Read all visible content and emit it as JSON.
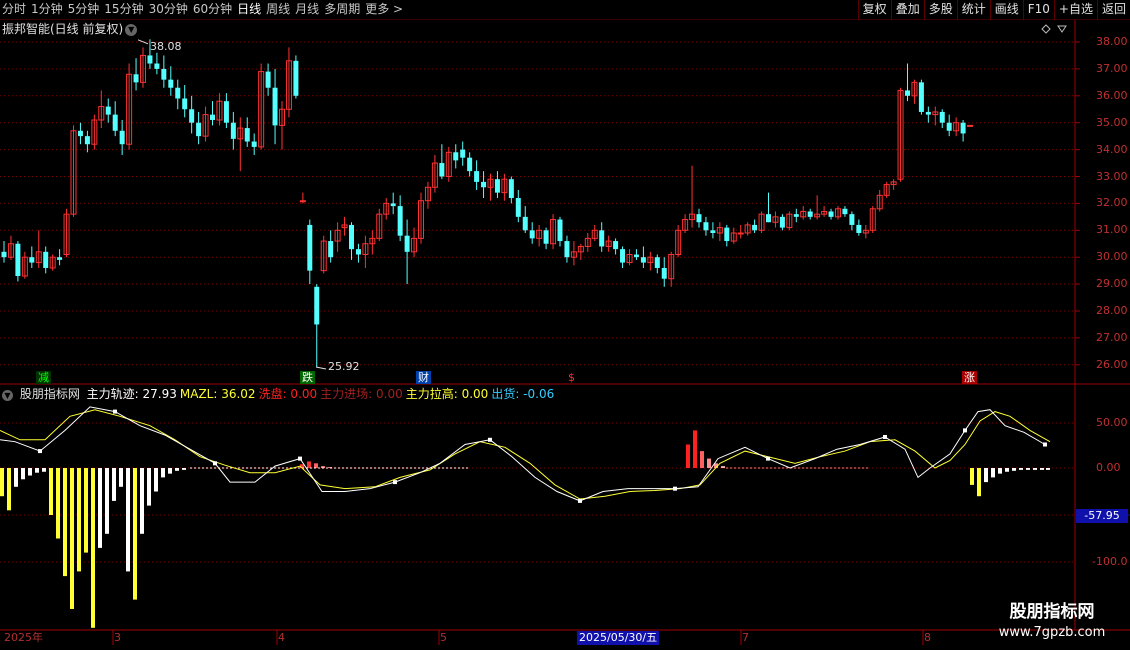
{
  "toolbar": {
    "periods": [
      "分时",
      "1分钟",
      "5分钟",
      "15分钟",
      "30分钟",
      "60分钟",
      "日线",
      "周线",
      "月线",
      "多周期",
      "更多 >"
    ],
    "active": "日线",
    "right_buttons": [
      "复权",
      "叠加",
      "多股",
      "统计",
      "画线",
      "F10",
      "+自选",
      "返回"
    ]
  },
  "stock": {
    "title": "振邦智能(日线 前复权)"
  },
  "price_axis": [
    "38.00",
    "37.00",
    "36.00",
    "35.00",
    "34.00",
    "33.00",
    "32.00",
    "31.00",
    "30.00",
    "29.00",
    "28.00",
    "27.00",
    "26.00"
  ],
  "annotations": {
    "high": "38.08",
    "low": "25.92"
  },
  "markers": [
    "减",
    "跌",
    "财",
    "$",
    "涨"
  ],
  "indicator": {
    "name": "股朋指标网",
    "fields": [
      {
        "label": "主力轨迹: 27.93",
        "color": "#ffffff"
      },
      {
        "label": "MAZL: 36.02",
        "color": "#ffff33"
      },
      {
        "label": "洗盘: 0.00",
        "color": "#ff2020"
      },
      {
        "label": "主力进场: 0.00",
        "color": "#a02020"
      },
      {
        "label": "主力拉高: 0.00",
        "color": "#ffff33"
      },
      {
        "label": "出货: -0.06",
        "color": "#33ccff"
      }
    ],
    "axis": [
      "50.00",
      "0.00",
      "-100.0"
    ],
    "cursor_value": "-57.95"
  },
  "dates": [
    "2025年",
    "3",
    "4",
    "5",
    "7",
    "8"
  ],
  "date_highlight": "2025/05/30/五",
  "watermark": {
    "title": "股朋指标网",
    "url": "www.7gpzb.com"
  },
  "colors": {
    "up": "#ff3232",
    "down": "#54ffff",
    "grid": "#7a0000"
  }
}
